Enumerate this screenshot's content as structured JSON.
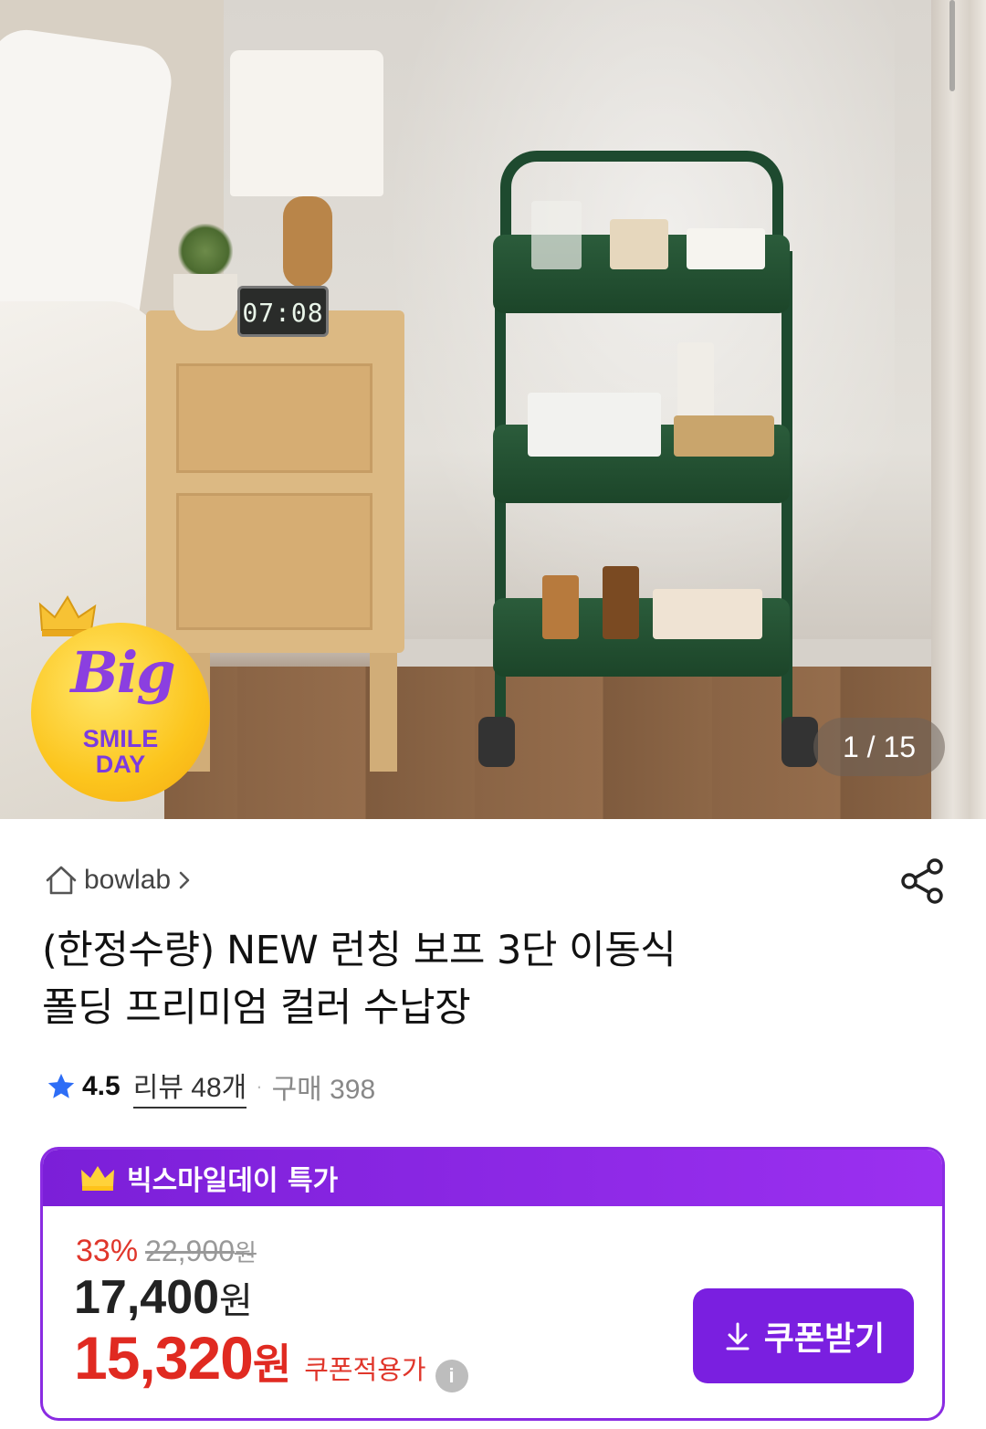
{
  "gallery": {
    "counter": "1 / 15",
    "clock_display": "07:08",
    "badge": {
      "big": "Big",
      "line1": "SMILE",
      "line2": "DAY",
      "color": "#8b3fe0"
    }
  },
  "store": {
    "icon": "home-icon",
    "name": "bowlab",
    "chevron": "›"
  },
  "share_icon": "share-icon",
  "product": {
    "title_line1": "(한정수량) NEW 런칭 보프 3단 이동식",
    "title_line2": "폴딩 프리미엄 컬러 수납장"
  },
  "rating": {
    "score": "4.5",
    "reviews": "리뷰 48개",
    "separator": "·",
    "purchases": "구매 398"
  },
  "price": {
    "header_label": "빅스마일데이 특가",
    "discount_rate": "33%",
    "original_price": "22,900",
    "original_unit": "원",
    "sale_price": "17,400",
    "sale_unit": "원",
    "coupon_price": "15,320",
    "coupon_unit": "원",
    "coupon_label": "쿠폰적용가",
    "info_icon": "i",
    "coupon_button": "쿠폰받기"
  },
  "colors": {
    "accent": "#8a2be2",
    "price_red": "#e02a21",
    "star": "#2d6df6"
  }
}
